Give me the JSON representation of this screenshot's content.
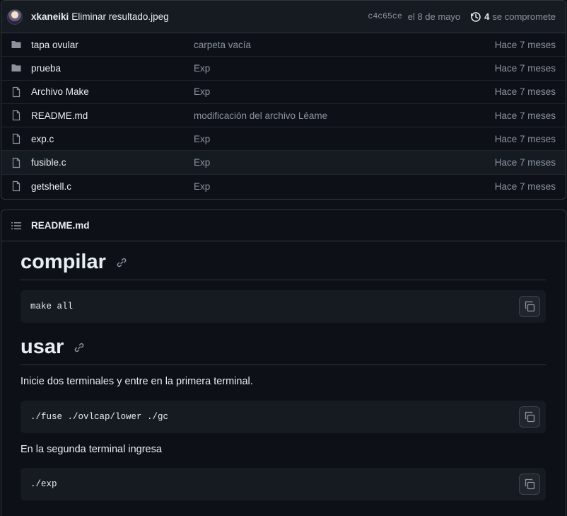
{
  "commit": {
    "author": "xkaneiki",
    "message": "Eliminar resultado.jpeg",
    "sha": "c4c65ce",
    "date": "el 8 de mayo",
    "count": "4",
    "count_label": "se compromete"
  },
  "files": [
    {
      "type": "folder",
      "name": "tapa ovular",
      "message": "carpeta vacía",
      "age": "Hace 7 meses"
    },
    {
      "type": "folder",
      "name": "prueba",
      "message": "Exp",
      "age": "Hace 7 meses"
    },
    {
      "type": "file",
      "name": "Archivo Make",
      "message": "Exp",
      "age": "Hace 7 meses"
    },
    {
      "type": "file",
      "name": "README.md",
      "message": "modificación del archivo Léame",
      "age": "Hace 7 meses"
    },
    {
      "type": "file",
      "name": "exp.c",
      "message": "Exp",
      "age": "Hace 7 meses"
    },
    {
      "type": "file",
      "name": "fusible.c",
      "message": "Exp",
      "age": "Hace 7 meses"
    },
    {
      "type": "file",
      "name": "getshell.c",
      "message": "Exp",
      "age": "Hace 7 meses"
    }
  ],
  "readme": {
    "title": "README.md",
    "h_compile": "compilar",
    "code_compile": "make all",
    "h_use": "usar",
    "p1": "Inicie dos terminales y entre en la primera terminal.",
    "code_1": "./fuse ./ovlcap/lower ./gc",
    "p2": "En la segunda terminal ingresa",
    "code_2": "./exp"
  },
  "icons": {
    "folder": "folder-icon",
    "file": "file-icon",
    "history": "history-icon",
    "list": "list-icon",
    "link": "link-icon",
    "copy": "copy-icon"
  },
  "colors": {
    "background": "#0d1117",
    "panel": "#161b22",
    "border": "#30363d",
    "muted_text": "#8b949e",
    "text": "#e6edf3"
  }
}
